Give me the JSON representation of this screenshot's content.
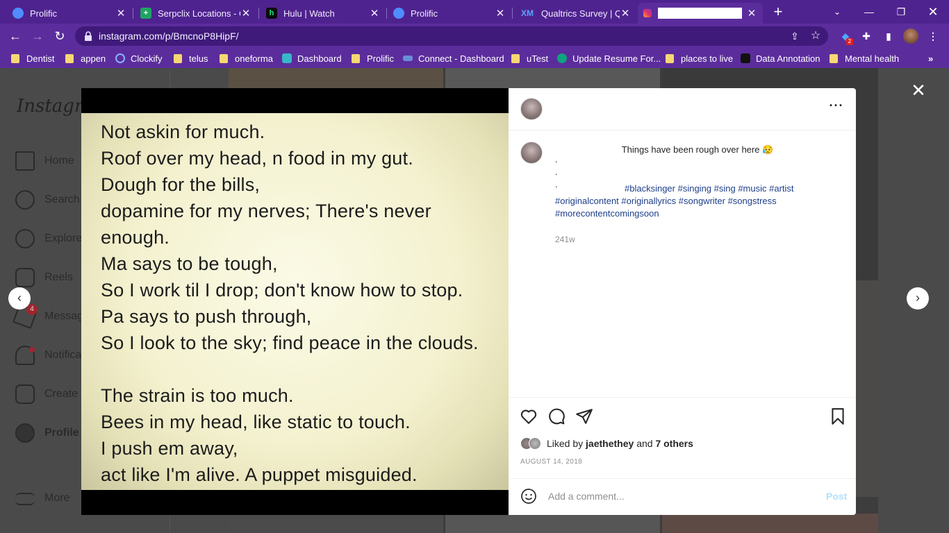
{
  "browser": {
    "tabs": [
      {
        "title": "Prolific",
        "icon": "prolific-icon",
        "color": "#4f8cff"
      },
      {
        "title": "Serpclix Locations - Go",
        "icon": "sheets-icon",
        "color": "#1fa463"
      },
      {
        "title": "Hulu | Watch",
        "icon": "hulu-icon",
        "color": "#1ce783"
      },
      {
        "title": "Prolific",
        "icon": "prolific-icon",
        "color": "#4f8cff"
      },
      {
        "title": "Qualtrics Survey | Qua",
        "icon": "qualtrics-icon",
        "color": "#2f7bff"
      },
      {
        "title": "",
        "icon": "instagram-icon",
        "color": "#e1306c"
      }
    ],
    "url": "instagram.com/p/BmcnoP8HipF/",
    "extension_badge": "2",
    "bookmarks": [
      {
        "label": "Dentist",
        "type": "folder"
      },
      {
        "label": "appen",
        "type": "folder"
      },
      {
        "label": "Clockify",
        "type": "site"
      },
      {
        "label": "telus",
        "type": "folder"
      },
      {
        "label": "oneforma",
        "type": "folder"
      },
      {
        "label": "Dashboard",
        "type": "site"
      },
      {
        "label": "Prolific",
        "type": "folder"
      },
      {
        "label": "Connect - Dashboard",
        "type": "site"
      },
      {
        "label": "uTest",
        "type": "folder"
      },
      {
        "label": "Update Resume For...",
        "type": "site"
      },
      {
        "label": "places to live",
        "type": "folder"
      },
      {
        "label": "Data Annotation",
        "type": "site"
      },
      {
        "label": "Mental health",
        "type": "folder"
      }
    ]
  },
  "instagram": {
    "logo": "Instagram",
    "nav": [
      "Home",
      "Search",
      "Explore",
      "Reels",
      "Messages",
      "Notifications",
      "Create",
      "Profile",
      "More"
    ],
    "messages_badge": "4"
  },
  "post": {
    "poem_lines": [
      "Not askin for much.",
      "Roof over my head, n food in my gut.",
      "Dough for the bills,",
      "dopamine for my nerves; There's never",
      "enough.",
      "Ma says to be tough,",
      "So I work til I drop; don't know how to stop.",
      "Pa says to push through,",
      "So I look to the sky; find peace in the clouds.",
      "",
      "The strain is too much.",
      "Bees in my head, like static to touch.",
      "I push em away,",
      "act like I'm alive. A puppet misguided."
    ],
    "caption": "Things have been rough over here 😥",
    "caption_dots": [
      ".",
      ".",
      "."
    ],
    "hashtags": "#blacksinger #singing #sing #music #artist #originalcontent #originallyrics #songwriter #songstress #morecontentcomingsoon",
    "age": "241w",
    "liked_by_prefix": "Liked by",
    "liked_by_user": "jaethethey",
    "liked_by_and": "and",
    "liked_by_others": "7 others",
    "date": "AUGUST 14, 2018",
    "comment_placeholder": "Add a comment...",
    "post_label": "Post"
  }
}
